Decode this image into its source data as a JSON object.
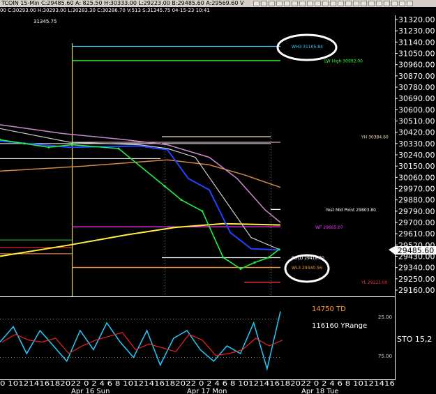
{
  "header": {
    "title": "TCOIN  15-Min  C:29485.60  A:  825.50  H:30333.00  L:29223.00  B:29485.60  A:29569.60  V",
    "ohlc": "00  C:30293.00  H:30293.00  L:30283.30  C:30286.70  V:513  S:31345.75  04-15-23  10:41",
    "cursor_price": "31345.75"
  },
  "price_axis": {
    "ticks": [
      "31320.00",
      "31230.00",
      "31140.00",
      "31050.00",
      "30960.00",
      "30870.00",
      "30780.00",
      "30690.00",
      "30600.00",
      "30510.00",
      "30420.00",
      "30330.00",
      "30240.00",
      "30150.00",
      "30060.00",
      "29970.00",
      "29880.00",
      "29790.00",
      "29700.00",
      "29610.00",
      "29520.00",
      "29430.00",
      "29340.00",
      "29250.00",
      "29160.00"
    ],
    "last_price": "29485.60"
  },
  "levels": [
    {
      "label": "WH3  31105.84",
      "price": 31105.84,
      "color": "#33ccff",
      "circled": true
    },
    {
      "label": "LW High  30992.00",
      "price": 30992,
      "color": "#33ff33"
    },
    {
      "label": "YH  30384.60",
      "price": 30384.6,
      "color": "#f5deb3"
    },
    {
      "label": "Yest Mid Point  29803.80",
      "price": 29803.8,
      "color": "#ffffff"
    },
    {
      "label": "WF  29665.07",
      "price": 29665.07,
      "color": "#ff33ff"
    },
    {
      "label": "POLD  29418.70",
      "price": 29418.7,
      "color": "#ffffff"
    },
    {
      "label": "WL3  29340.56",
      "price": 29340.56,
      "color": "#ff9933",
      "circled": true
    },
    {
      "label": "YL  29223.00",
      "price": 29223,
      "color": "#ff3333"
    }
  ],
  "indicator": {
    "td_text": "14750 TD",
    "yrange_text": "116160 YRange",
    "sto_text": "STO  15,2",
    "ticks": [
      "25.00",
      "75.00"
    ]
  },
  "time_axis": {
    "hours_text": "0 10121416182022  0  2  4  6  8 10121416182022  0  2  4  6  8 10121416182022  0  2  4  6  8 10121416",
    "days": [
      "Apr 16 Sun",
      "Apr 17 Mon",
      "Apr 18 Tue"
    ]
  },
  "chart_data": {
    "type": "line",
    "title": "TCOIN 15-Min",
    "ylim": [
      29160,
      31320
    ],
    "x": [
      "Apr 16 00:00",
      "Apr 16 06:00",
      "Apr 16 12:00",
      "Apr 16 18:00",
      "Apr 17 00:00",
      "Apr 17 04:00",
      "Apr 17 06:00",
      "Apr 17 08:00",
      "Apr 17 10:00",
      "Apr 17 12:00",
      "Apr 17 14:00",
      "Apr 17 16:00",
      "Apr 17 18:00"
    ],
    "series": [
      {
        "values": [
          30360,
          30330,
          30300,
          30320,
          30290,
          29990,
          29880,
          29790,
          29420,
          29330,
          29380,
          29420,
          29485
        ]
      }
    ],
    "indicator_series": {
      "sto": [
        55,
        35,
        70,
        40,
        60,
        80,
        40,
        65,
        30,
        55,
        75,
        40,
        85,
        50,
        40,
        65,
        80,
        60,
        70,
        30,
        90,
        15
      ]
    },
    "grid": false
  }
}
